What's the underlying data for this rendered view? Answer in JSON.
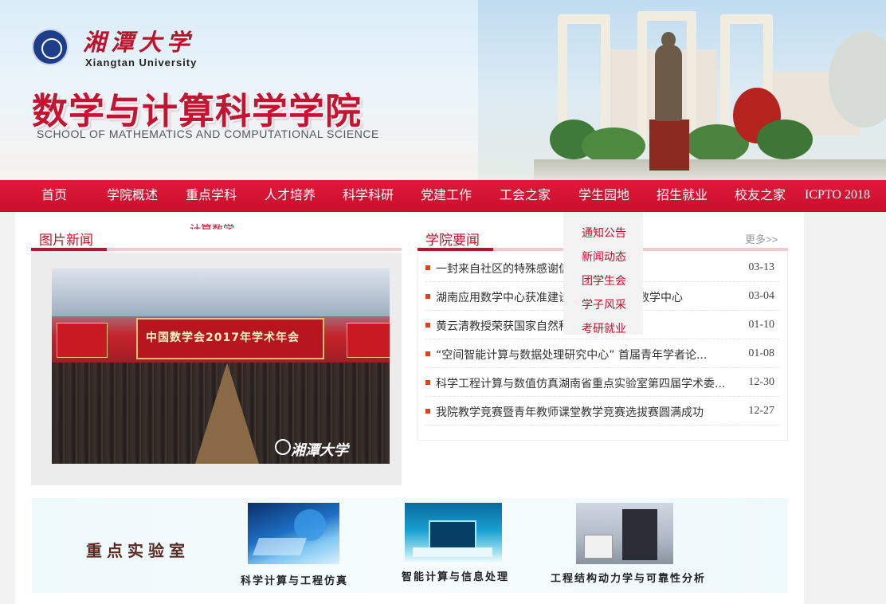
{
  "header": {
    "university_cn": "湘潭大学",
    "university_en": "Xiangtan University",
    "school_cn": "数学与计算科学学院",
    "school_en": "SCHOOL OF MATHEMATICS AND COMPUTATIONAL SCIENCE"
  },
  "nav": {
    "items": [
      {
        "label": "首页"
      },
      {
        "label": "学院概述"
      },
      {
        "label": "重点学科"
      },
      {
        "label": "人才培养"
      },
      {
        "label": "科学科研"
      },
      {
        "label": "党建工作"
      },
      {
        "label": "工会之家"
      },
      {
        "label": "学生园地"
      },
      {
        "label": "招生就业"
      },
      {
        "label": "校友之家"
      },
      {
        "label": "ICPTO 2018"
      }
    ]
  },
  "dropdown_subject": {
    "partial_label": "计算数学"
  },
  "dropdown_student": {
    "items": [
      "通知公告",
      "新闻动态",
      "团学生会",
      "学子风采",
      "考研就业"
    ]
  },
  "photo_news": {
    "title": "图片新闻",
    "stage_text": "中国数学会2017年学术年会",
    "watermark": "湘潭大学"
  },
  "college_news": {
    "title": "学院要闻",
    "more": "更多>>",
    "items": [
      {
        "text": "一封来自社区的特殊感谢信",
        "date": "03-13"
      },
      {
        "text": "湖南应用数学中心获准建设",
        "tail": "数学中心",
        "date": "03-04"
      },
      {
        "text": "黄云清教授荣获国家自然科",
        "date": "01-10"
      },
      {
        "text": "“空间智能计算与数据处理研究中心” 首届青年学者论...",
        "date": "01-08"
      },
      {
        "text": "科学工程计算与数值仿真湖南省重点实验室第四届学术委...",
        "date": "12-30"
      },
      {
        "text": "我院教学竞赛暨青年教师课堂教学竞赛选拔赛圆满成功",
        "date": "12-27"
      }
    ]
  },
  "labs": {
    "title": "重点实验室",
    "items": [
      {
        "caption": "科学计算与工程仿真"
      },
      {
        "caption": "智能计算与信息处理"
      },
      {
        "caption": "工程结构动力学与可靠性分析"
      }
    ]
  },
  "colors": {
    "brand_red": "#c0112b",
    "nav_red": "#d8142f",
    "bullet_orange": "#e0401a"
  }
}
